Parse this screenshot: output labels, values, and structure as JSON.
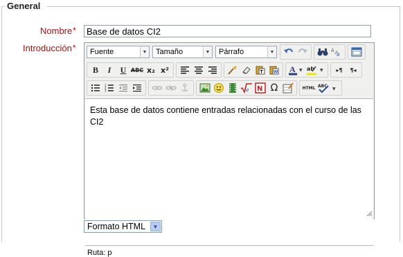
{
  "fieldset": {
    "legend": "General"
  },
  "form": {
    "name_label": "Nombre",
    "name_value": "Base de datos CI2",
    "intro_label": "Introducción",
    "required_marker": "*"
  },
  "editor": {
    "font_select": "Fuente",
    "size_select": "Tamaño",
    "paragraph_select": "Párrafo",
    "content_text": "Esta base de datos contiene entradas relacionadas con el curso de las CI2",
    "status_path": "Ruta: p",
    "buttons": {
      "bold": "B",
      "italic": "I",
      "underline": "U",
      "strike": "ABC",
      "subscript": "x₂",
      "superscript": "x²",
      "ltr": "▸¶",
      "rtl": "¶◂",
      "html": "HTML",
      "omega": "Ω"
    }
  },
  "format": {
    "selected": "Formato HTML"
  },
  "colors": {
    "label": "#a01414",
    "required": "#cc0000",
    "border": "#9a9a9a",
    "toolbar_bg": "#f0f0ee",
    "select_arrow_bg": "#b9cdf2"
  }
}
